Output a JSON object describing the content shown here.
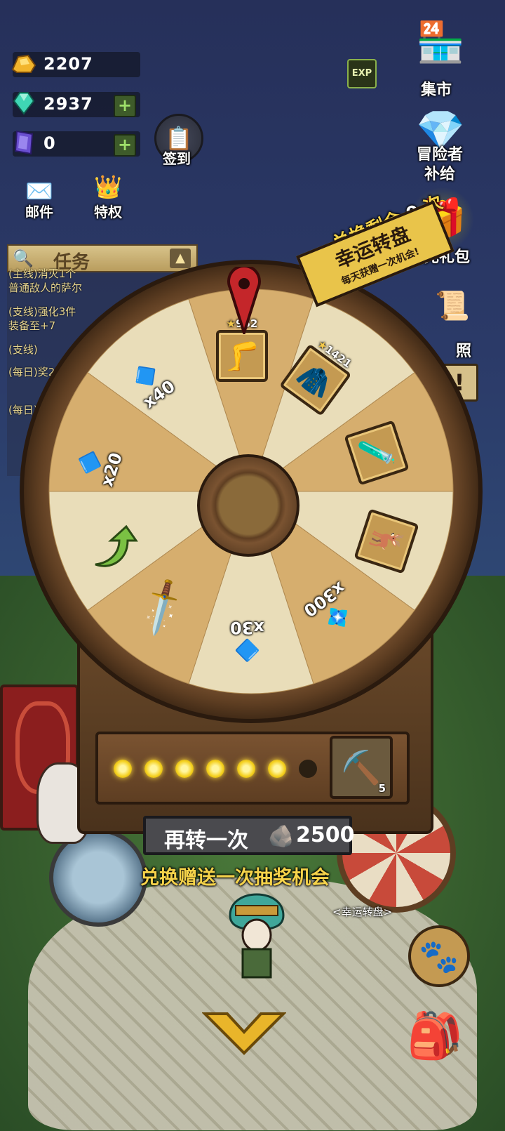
{
  "resources": {
    "gold": {
      "value": "2207",
      "icon": "gold-icon"
    },
    "gems": {
      "value": "2937",
      "icon": "gem-icon",
      "plus": "+"
    },
    "crystal": {
      "value": "0",
      "icon": "purple-crystal-icon",
      "plus": "+"
    }
  },
  "buttons": {
    "checkin": "签到",
    "mail": "邮件",
    "privilege": "特权",
    "exp": "EXP"
  },
  "right_menu": {
    "market": "集市",
    "adventurer_supply": [
      "冒险者",
      "补给"
    ],
    "first_recharge": "首充礼包",
    "photo": "照"
  },
  "quests": {
    "title": "任务",
    "collapse": "▲",
    "items": [
      "(主线)消灭1个普通敌人的萨尔坦",
      "(支线)强化3件装备至+7",
      "(支线)",
      "(每日)奖2次",
      "(每日)内"
    ]
  },
  "wheel": {
    "exchange_label": "兑换剩余",
    "exchange_count": "9",
    "exchange_unit": "次",
    "title": "幸运转盘",
    "subtitle": "每天获赠一次机会!",
    "segments": [
      {
        "kind": "equipment",
        "icon": "leg-armor-icon",
        "stars": "952"
      },
      {
        "kind": "equipment",
        "icon": "cloak-armor-icon",
        "stars": "1421"
      },
      {
        "kind": "item",
        "icon": "purple-potion-icon"
      },
      {
        "kind": "item",
        "icon": "antler-material-icon"
      },
      {
        "kind": "currency",
        "icon": "green-gem-icon",
        "qty": "x300"
      },
      {
        "kind": "currency",
        "icon": "blue-ore-icon",
        "qty": "x30"
      },
      {
        "kind": "item",
        "icon": "green-dagger-icon"
      },
      {
        "kind": "retry",
        "icon": "green-retry-arrow-icon"
      },
      {
        "kind": "currency",
        "icon": "blue-ore-icon",
        "qty": "x20"
      },
      {
        "kind": "currency",
        "icon": "blue-ore-icon",
        "qty": "x40"
      }
    ],
    "progress_total": 7,
    "progress_filled": 6,
    "pickaxe_count": "5",
    "spin_again": "再转一次",
    "spin_cost": "2500",
    "hint": "兑换赠送一次抽奖机会",
    "sign": "<幸运转盘>"
  },
  "colors": {
    "accent_yellow": "#f5d34a",
    "wheel_light": "#e9ddb9",
    "wheel_dark": "#d6ae6e",
    "rim": "#5e3e22"
  }
}
